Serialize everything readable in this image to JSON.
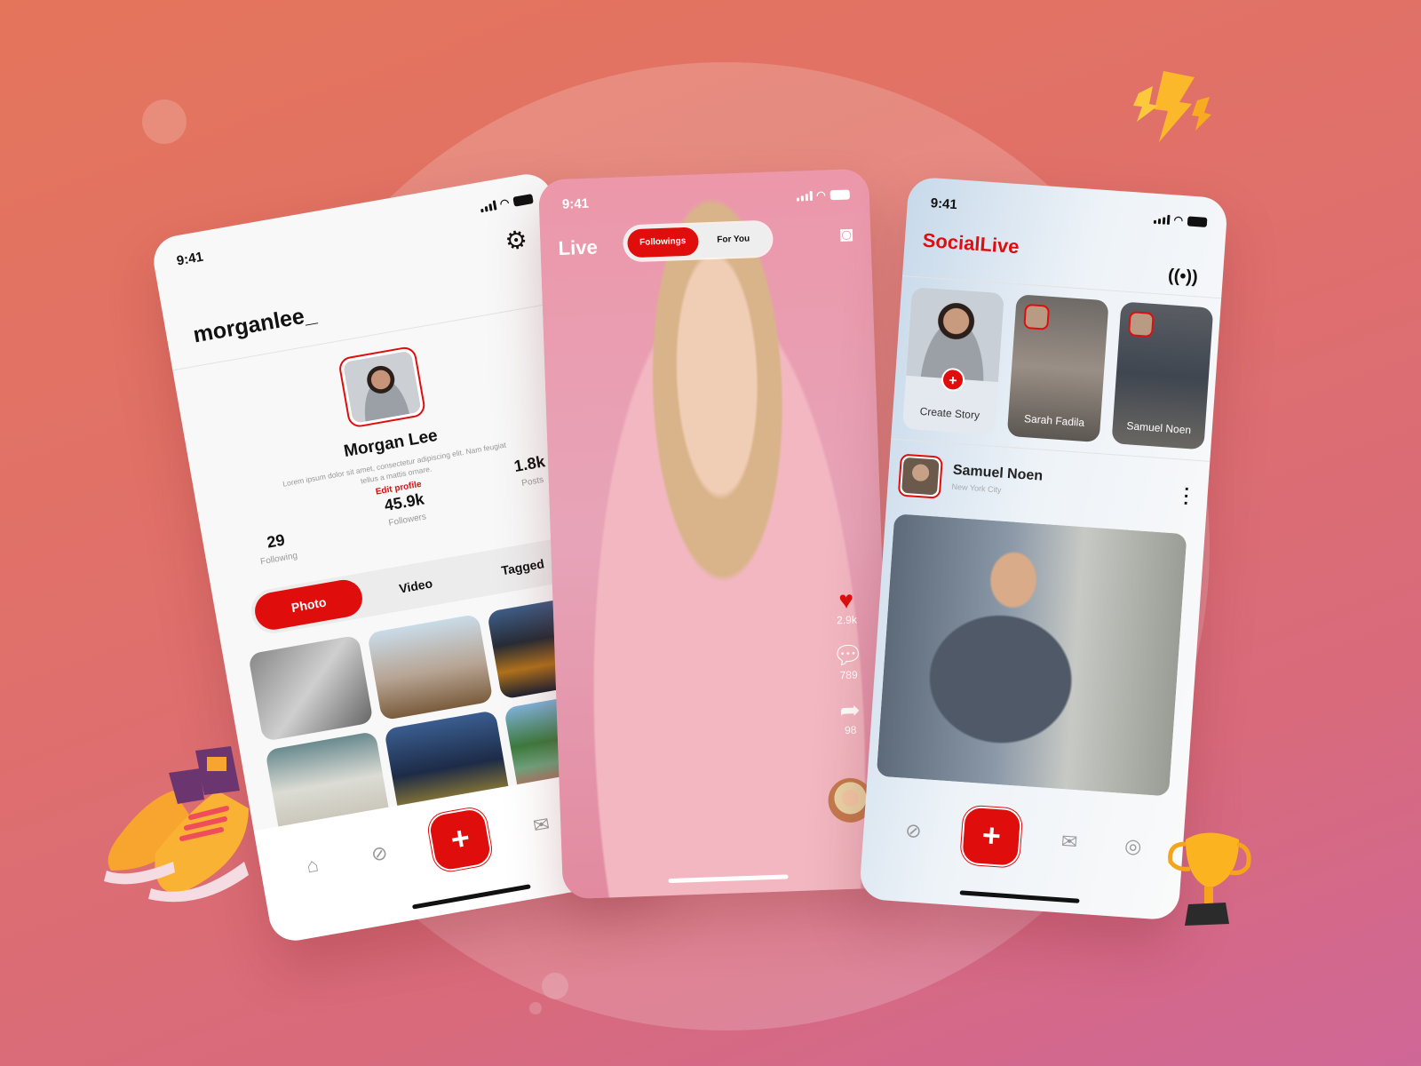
{
  "profile_screen": {
    "status_time": "9:41",
    "username": "morganlee_",
    "full_name": "Morgan Lee",
    "bio": "Lorem ipsum dolor sit amet, consectetur adipiscing elit. Nam feugiat tellus a mattis ornare.",
    "edit_profile_label": "Edit profile",
    "stats": [
      {
        "value": "29",
        "label": "Following"
      },
      {
        "value": "45.9k",
        "label": "Followers"
      },
      {
        "value": "1.8k",
        "label": "Posts"
      }
    ],
    "tabs": [
      {
        "label": "Photo",
        "active": true
      },
      {
        "label": "Video",
        "active": false
      },
      {
        "label": "Tagged",
        "active": false
      }
    ],
    "nav_icons": [
      "home-icon",
      "compass-icon",
      "plus-icon",
      "mail-icon",
      "profile-icon"
    ],
    "active_nav": "profile-icon"
  },
  "live_screen": {
    "status_time": "9:41",
    "title": "Live",
    "segments": [
      {
        "label": "Followings",
        "active": true
      },
      {
        "label": "For You",
        "active": false
      }
    ],
    "actions": [
      {
        "icon": "heart-icon",
        "count": "2.9k"
      },
      {
        "icon": "comment-icon",
        "count": "789"
      },
      {
        "icon": "share-icon",
        "count": "98"
      }
    ]
  },
  "feed_screen": {
    "status_time": "9:41",
    "brand": "SocialLive",
    "stories": [
      {
        "label": "Create Story",
        "type": "create"
      },
      {
        "label": "Sarah Fadila",
        "type": "story"
      },
      {
        "label": "Samuel Noen",
        "type": "story"
      }
    ],
    "post": {
      "author": "Samuel Noen",
      "location": "New York City"
    }
  },
  "colors": {
    "accent": "#e00d0d",
    "background_start": "#e4755b",
    "background_end": "#cf6797"
  }
}
